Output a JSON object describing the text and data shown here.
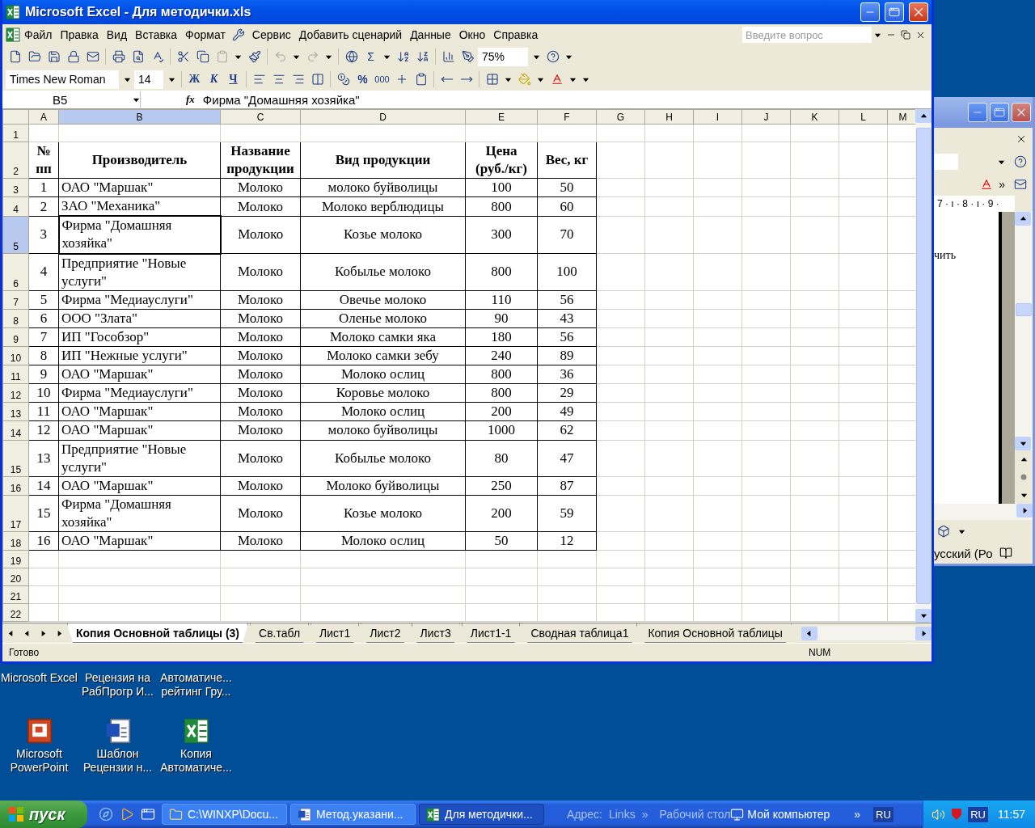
{
  "window": {
    "title": "Microsoft Excel - Для методички.xls"
  },
  "menu": {
    "items": [
      "Файл",
      "Правка",
      "Вид",
      "Вставка",
      "Формат",
      "Сервис",
      "Добавить сценарий",
      "Данные",
      "Окно",
      "Справка"
    ],
    "search": {
      "placeholder": "Введите вопрос"
    }
  },
  "toolbar": {
    "sum": "Σ",
    "zoom": "75%"
  },
  "format_toolbar": {
    "font": "Times New Roman",
    "size": "14",
    "bold": "Ж",
    "italic": "К",
    "underline": "Ч",
    "percent": "%",
    "thousands": "000"
  },
  "formula_bar": {
    "name_box": "B5",
    "fx": "fx",
    "formula": "Фирма \"Домашняя хозяйка\""
  },
  "sheet": {
    "columns": [
      {
        "label": "A",
        "selected": false
      },
      {
        "label": "B",
        "selected": true
      },
      {
        "label": "C",
        "selected": false
      },
      {
        "label": "D",
        "selected": false
      },
      {
        "label": "E",
        "selected": false
      },
      {
        "label": "F",
        "selected": false
      },
      {
        "label": "G",
        "selected": false
      },
      {
        "label": "H",
        "selected": false
      },
      {
        "label": "I",
        "selected": false
      },
      {
        "label": "J",
        "selected": false
      },
      {
        "label": "K",
        "selected": false
      },
      {
        "label": "L",
        "selected": false
      },
      {
        "label": "M",
        "selected": false
      }
    ],
    "rows": [
      {
        "label": "1",
        "kind": "blank",
        "selected": false
      },
      {
        "label": "2",
        "kind": "header",
        "selected": false,
        "cells": [
          "№ пп",
          "Производитель",
          "Название продукции",
          "Вид продукции",
          "Цена (руб./кг)",
          "Вес, кг"
        ]
      },
      {
        "label": "3",
        "kind": "record",
        "selected": false,
        "cells": [
          "1",
          "ОАО \"Маршак\"",
          "Молоко",
          "молоко буйволицы",
          "100",
          "50"
        ]
      },
      {
        "label": "4",
        "kind": "record",
        "selected": false,
        "cells": [
          "2",
          "ЗАО \"Механика\"",
          "Молоко",
          "Молоко верблюдицы",
          "800",
          "60"
        ]
      },
      {
        "label": "5",
        "kind": "record",
        "selected": true,
        "cells": [
          "3",
          "Фирма \"Домашняя хозяйка\"",
          "Молоко",
          "Козье молоко",
          "300",
          "70"
        ]
      },
      {
        "label": "6",
        "kind": "record",
        "selected": false,
        "cells": [
          "4",
          "Предприятие \"Новые услуги\"",
          "Молоко",
          "Кобылье молоко",
          "800",
          "100"
        ]
      },
      {
        "label": "7",
        "kind": "record",
        "selected": false,
        "cells": [
          "5",
          "Фирма \"Медиауслуги\"",
          "Молоко",
          "Овечье молоко",
          "110",
          "56"
        ]
      },
      {
        "label": "8",
        "kind": "record",
        "selected": false,
        "cells": [
          "6",
          "ООО \"Злата\"",
          "Молоко",
          "Оленье молоко",
          "90",
          "43"
        ]
      },
      {
        "label": "9",
        "kind": "record",
        "selected": false,
        "cells": [
          "7",
          "ИП \"Гособзор\"",
          "Молоко",
          "Молоко самки яка",
          "180",
          "56"
        ]
      },
      {
        "label": "10",
        "kind": "record",
        "selected": false,
        "cells": [
          "8",
          "ИП \"Нежные услуги\"",
          "Молоко",
          "Молоко самки зебу",
          "240",
          "89"
        ]
      },
      {
        "label": "11",
        "kind": "record",
        "selected": false,
        "cells": [
          "9",
          "ОАО \"Маршак\"",
          "Молоко",
          "Молоко ослиц",
          "800",
          "36"
        ]
      },
      {
        "label": "12",
        "kind": "record",
        "selected": false,
        "cells": [
          "10",
          "Фирма \"Медиауслуги\"",
          "Молоко",
          "Коровье молоко",
          "800",
          "29"
        ]
      },
      {
        "label": "13",
        "kind": "record",
        "selected": false,
        "cells": [
          "11",
          "ОАО \"Маршак\"",
          "Молоко",
          "Молоко ослиц",
          "200",
          "49"
        ]
      },
      {
        "label": "14",
        "kind": "record",
        "selected": false,
        "cells": [
          "12",
          "ОАО \"Маршак\"",
          "Молоко",
          "молоко буйволицы",
          "1000",
          "62"
        ]
      },
      {
        "label": "15",
        "kind": "record",
        "selected": false,
        "cells": [
          "13",
          "Предприятие \"Новые услуги\"",
          "Молоко",
          "Кобылье молоко",
          "80",
          "47"
        ]
      },
      {
        "label": "16",
        "kind": "record",
        "selected": false,
        "cells": [
          "14",
          "ОАО \"Маршак\"",
          "Молоко",
          "Молоко буйволицы",
          "250",
          "87"
        ]
      },
      {
        "label": "17",
        "kind": "record",
        "selected": false,
        "cells": [
          "15",
          "Фирма \"Домашняя хозяйка\"",
          "Молоко",
          "Козье молоко",
          "200",
          "59"
        ]
      },
      {
        "label": "18",
        "kind": "record",
        "selected": false,
        "cells": [
          "16",
          "ОАО \"Маршак\"",
          "Молоко",
          "Молоко ослиц",
          "50",
          "12"
        ]
      },
      {
        "label": "19",
        "kind": "blank",
        "selected": false
      },
      {
        "label": "20",
        "kind": "blank",
        "selected": false
      },
      {
        "label": "21",
        "kind": "blank",
        "selected": false
      },
      {
        "label": "22",
        "kind": "blank",
        "selected": false
      }
    ]
  },
  "sheet_tabs": [
    {
      "label": "Копия Основной таблицы (3)",
      "selected": true
    },
    {
      "label": "Св.табл",
      "selected": false
    },
    {
      "label": "Лист1",
      "selected": false
    },
    {
      "label": "Лист2",
      "selected": false
    },
    {
      "label": "Лист3",
      "selected": false
    },
    {
      "label": "Лист1-1",
      "selected": false
    },
    {
      "label": "Сводная таблица1",
      "selected": false
    },
    {
      "label": "Копия Основной таблицы",
      "selected": false
    }
  ],
  "status_bar": {
    "state": "Готово",
    "num": "NUM"
  },
  "background_window": {
    "overflow": "»",
    "ruler": "7 · ı · 8 · ı · 9 ·",
    "document_text": "чить",
    "language": "усский (Ро"
  },
  "desktop_icons": [
    {
      "label": "Microsoft Excel"
    },
    {
      "label": "Рецензия на РабПрогр И..."
    },
    {
      "label": "Автоматиче... рейтинг Гру..."
    },
    {
      "label": "Microsoft PowerPoint",
      "kind": "presentation"
    },
    {
      "label": "Шаблон Рецензии н...",
      "kind": "document"
    },
    {
      "label": "Копия Автоматиче...",
      "kind": "spreadsheet"
    }
  ],
  "taskbar": {
    "start": "пуск",
    "tasks": [
      {
        "label": "C:\\WINXP\\Docu...",
        "kind": "folder",
        "selected": false
      },
      {
        "label": "Метод.указани...",
        "kind": "document",
        "selected": false
      },
      {
        "label": "Для методички...",
        "kind": "spreadsheet",
        "selected": true
      }
    ],
    "address": "Адрес:",
    "links": "Links",
    "more": "»",
    "desktop": "Рабочий стол",
    "computer": "Мой компьютер",
    "more_2": "»",
    "language": "RU",
    "tray_language": "RU",
    "clock": "11:57"
  }
}
